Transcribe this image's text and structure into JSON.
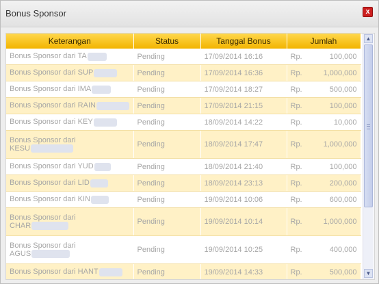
{
  "dialog": {
    "title": "Bonus Sponsor",
    "close_glyph": "x",
    "close_icon": "close-icon"
  },
  "table": {
    "columns": [
      "Keterangan",
      "Status",
      "Tanggal Bonus",
      "Jumlah"
    ],
    "header_color": "#f2b400",
    "row_alt_color": "#fff1c6",
    "rows": [
      {
        "desc": "Bonus Sponsor dari TA",
        "wrap": false,
        "status": "Pending",
        "date": "17/09/2014 16:16",
        "currency": "Rp.",
        "amount": "100,000"
      },
      {
        "desc": "Bonus Sponsor dari SUP",
        "wrap": false,
        "status": "Pending",
        "date": "17/09/2014 16:36",
        "currency": "Rp.",
        "amount": "1,000,000"
      },
      {
        "desc": "Bonus Sponsor dari IMA",
        "wrap": false,
        "status": "Pending",
        "date": "17/09/2014 18:27",
        "currency": "Rp.",
        "amount": "500,000"
      },
      {
        "desc": "Bonus Sponsor dari RAIN",
        "wrap": false,
        "status": "Pending",
        "date": "17/09/2014 21:15",
        "currency": "Rp.",
        "amount": "100,000"
      },
      {
        "desc": "Bonus Sponsor dari KEY",
        "wrap": false,
        "status": "Pending",
        "date": "18/09/2014 14:22",
        "currency": "Rp.",
        "amount": "10,000"
      },
      {
        "desc_line1": "Bonus Sponsor dari",
        "desc_line2": "KESU",
        "wrap": true,
        "status": "Pending",
        "date": "18/09/2014 17:47",
        "currency": "Rp.",
        "amount": "1,000,000"
      },
      {
        "desc": "Bonus Sponsor dari YUD",
        "wrap": false,
        "status": "Pending",
        "date": "18/09/2014 21:40",
        "currency": "Rp.",
        "amount": "100,000"
      },
      {
        "desc": "Bonus Sponsor dari LID",
        "wrap": false,
        "status": "Pending",
        "date": "18/09/2014 23:13",
        "currency": "Rp.",
        "amount": "200,000"
      },
      {
        "desc": "Bonus Sponsor dari KIN",
        "wrap": false,
        "status": "Pending",
        "date": "19/09/2014 10:06",
        "currency": "Rp.",
        "amount": "600,000"
      },
      {
        "desc_line1": "Bonus Sponsor dari",
        "desc_line2": "CHAR",
        "wrap": true,
        "status": "Pending",
        "date": "19/09/2014 10:14",
        "currency": "Rp.",
        "amount": "1,000,000"
      },
      {
        "desc_line1": "Bonus Sponsor dari",
        "desc_line2": "AGUS",
        "wrap": true,
        "status": "Pending",
        "date": "19/09/2014 10:25",
        "currency": "Rp.",
        "amount": "400,000"
      },
      {
        "desc": "Bonus Sponsor dari HANT",
        "wrap": false,
        "status": "Pending",
        "date": "19/09/2014 14:33",
        "currency": "Rp.",
        "amount": "500,000"
      }
    ]
  },
  "scrollbar": {
    "up_icon": "scroll-up-arrow-icon",
    "down_icon": "scroll-down-arrow-icon",
    "up_glyph": "▲",
    "down_glyph": "▼"
  }
}
